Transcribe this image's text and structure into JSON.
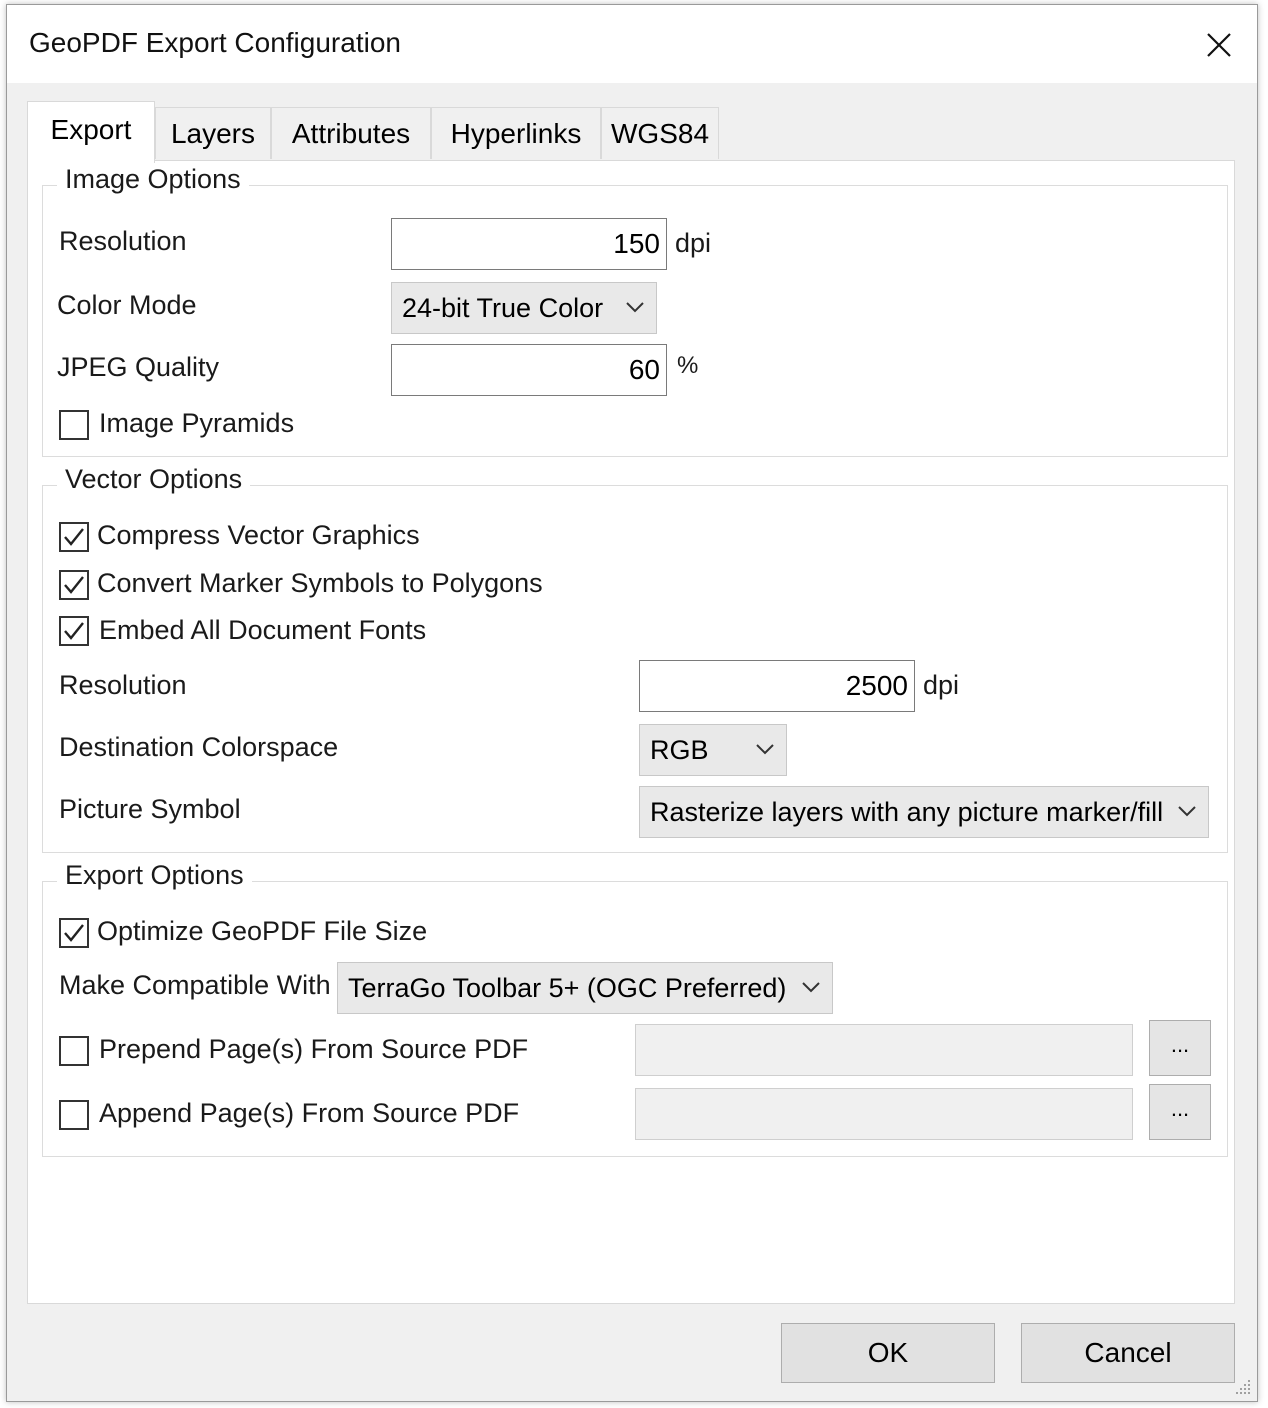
{
  "window": {
    "title": "GeoPDF Export Configuration"
  },
  "tabs": [
    {
      "label": "Export",
      "active": true
    },
    {
      "label": "Layers"
    },
    {
      "label": "Attributes"
    },
    {
      "label": "Hyperlinks"
    },
    {
      "label": "WGS84"
    }
  ],
  "image_options": {
    "legend": "Image Options",
    "resolution_label": "Resolution",
    "resolution_value": "150",
    "resolution_unit": "dpi",
    "color_mode_label": "Color Mode",
    "color_mode_value": "24-bit True Color",
    "jpeg_quality_label": "JPEG Quality",
    "jpeg_quality_value": "60",
    "jpeg_quality_unit": "%",
    "image_pyramids_label": "Image Pyramids",
    "image_pyramids_checked": false
  },
  "vector_options": {
    "legend": "Vector Options",
    "compress_label": "Compress Vector Graphics",
    "compress_checked": true,
    "convert_markers_label": "Convert Marker Symbols to Polygons",
    "convert_markers_checked": true,
    "embed_fonts_label": "Embed All Document Fonts",
    "embed_fonts_checked": true,
    "resolution_label": "Resolution",
    "resolution_value": "2500",
    "resolution_unit": "dpi",
    "colorspace_label": "Destination Colorspace",
    "colorspace_value": "RGB",
    "picture_symbol_label": "Picture Symbol",
    "picture_symbol_value": "Rasterize layers with any picture marker/fill"
  },
  "export_options": {
    "legend": "Export Options",
    "optimize_label": "Optimize GeoPDF File Size",
    "optimize_checked": true,
    "compatible_label": "Make Compatible With",
    "compatible_value": "TerraGo Toolbar 5+ (OGC Preferred)",
    "prepend_label": "Prepend Page(s) From Source PDF",
    "prepend_checked": false,
    "prepend_value": "",
    "append_label": "Append Page(s) From Source PDF",
    "append_checked": false,
    "append_value": "",
    "browse_label": "..."
  },
  "buttons": {
    "ok": "OK",
    "cancel": "Cancel"
  },
  "icons": {
    "close": "close-icon",
    "dropdown": "chevron-down-icon",
    "check": "checkmark-icon",
    "grip": "resize-grip-icon"
  },
  "colors": {
    "window_bg": "#f0f0f0",
    "panel_bg": "#ffffff",
    "button_bg": "#e1e1e1"
  }
}
